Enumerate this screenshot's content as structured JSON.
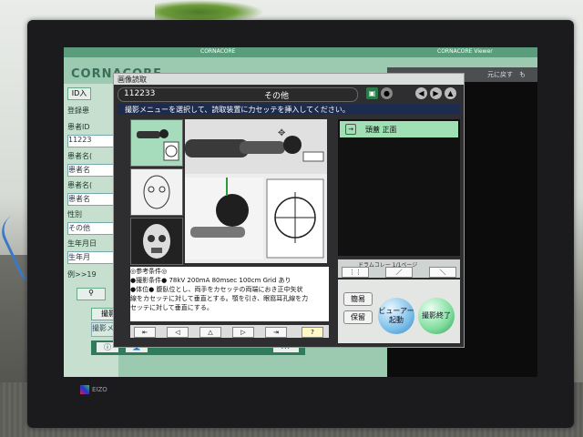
{
  "app": {
    "brand": "CORNACORE",
    "viewer_title": "CORNACORE Viewer",
    "monitor_brand": "EIZO"
  },
  "background_app": {
    "tab_id_input": "ID入",
    "left_labels": [
      "登録患",
      "患者ID",
      "患者名(",
      "患者名(",
      "性別",
      "生年月日"
    ],
    "field_values": [
      "11223",
      "患者名",
      "患者名",
      "その他",
      "生年月"
    ],
    "footer_text": "例>>19",
    "bottom_strip": "撮影メニュー",
    "bottom_tab": "撮影",
    "bottom_btn_right": "XT",
    "right_panel": {
      "btn1": "元に戻す",
      "btn2": "も"
    }
  },
  "dialog": {
    "title": "画像読取",
    "patient_id": "112233",
    "sono": "その他",
    "instruction": "撮影メニューを選択して、読取装置に力セッテを挿入してください。",
    "description_lines": [
      "◎参考条件◎",
      "●撮影条件● 78kV 200mA 80msec 100cm Grid あり",
      "●体位● 腹臥位とし、両手をカセッテの両端におき正中矢状",
      "線をカセッテに対して垂直とする。顎を引き、眼窩耳孔線を力",
      "セッテに対して垂直にする。"
    ],
    "menu_items": [
      {
        "label": "頭蓋 正面"
      }
    ],
    "pager_label": "1/1ページ",
    "pager_label_prefix": "ドラムコレー",
    "actions": {
      "simple": "簡易",
      "save": "保留",
      "viewer_launch": "ビューアー\n起動",
      "end_shoot": "撮影終了"
    },
    "icons": [
      "save-icon",
      "gear-icon",
      "back-icon",
      "forward-icon",
      "warning-icon"
    ]
  }
}
